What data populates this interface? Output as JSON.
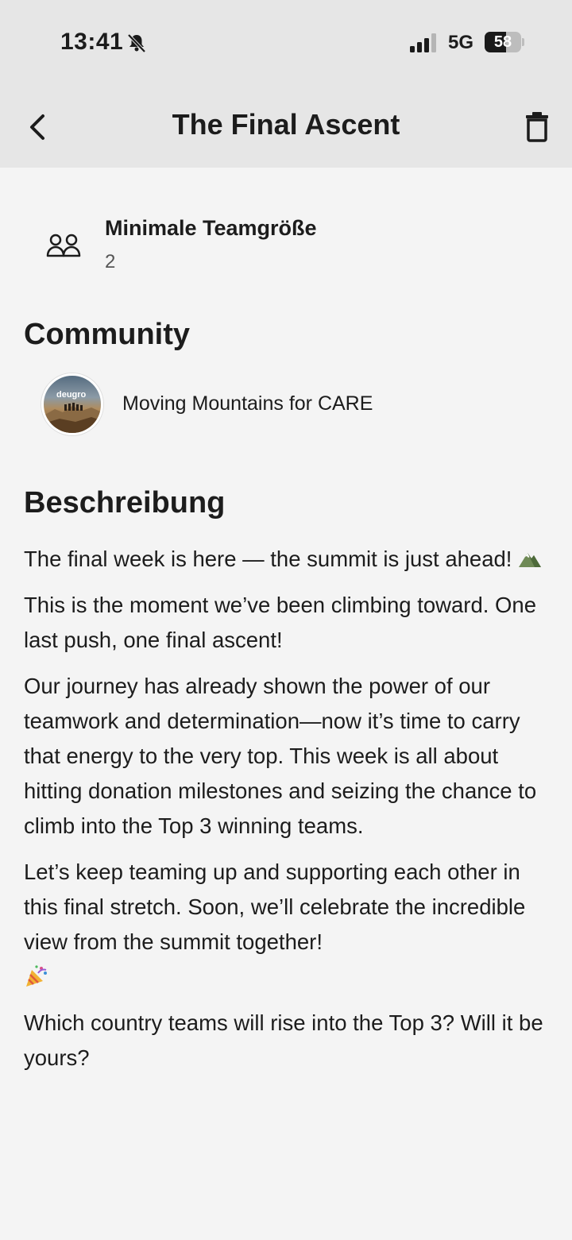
{
  "status_bar": {
    "time": "13:41",
    "network": "5G",
    "battery_level": "58",
    "battery_fraction": 0.58,
    "icons": [
      "bell-muted-icon",
      "signal-icon",
      "battery-icon"
    ]
  },
  "nav": {
    "title": "The Final Ascent",
    "back_icon": "chevron-left-icon",
    "delete_icon": "trash-icon"
  },
  "team_size": {
    "label": "Minimale Teamgröße",
    "value": "2",
    "icon": "group-icon"
  },
  "community": {
    "heading": "Community",
    "name": "Moving Mountains for CARE",
    "avatar_logo": "deugro"
  },
  "description": {
    "heading": "Beschreibung",
    "p1": "The final week is here — the summit is just ahead!",
    "p2": "This is the moment we’ve been climbing toward. One last push, one final ascent!",
    "p3": "Our journey has already shown the power of our teamwork and determination—now it’s time to carry that energy to the very top. This week is all about hitting donation milestones and seizing the chance to climb into the Top 3 winning teams.",
    "p4": "Let’s keep teaming up and supporting each other in this final stretch. Soon, we’ll celebrate the incredible view from the summit together!",
    "p5": "Which country teams will rise into the Top 3? Will it be yours?",
    "emoji_icons": [
      "mountain-emoji-icon",
      "party-popper-emoji-icon"
    ]
  }
}
